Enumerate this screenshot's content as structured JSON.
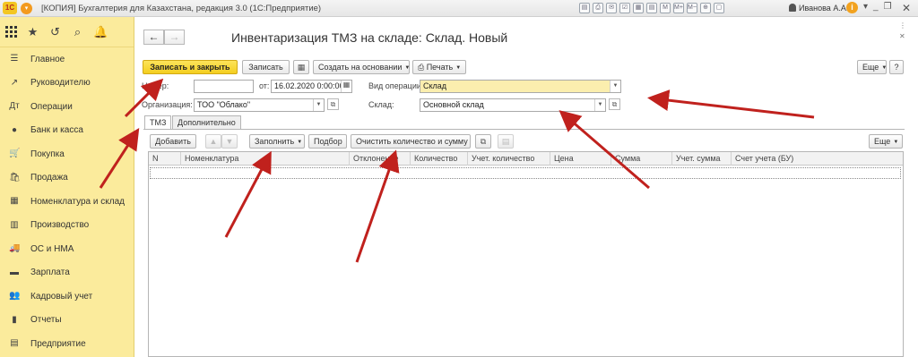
{
  "titlebar": {
    "logo": "1С",
    "title": "[КОПИЯ] Бухгалтерия для Казахстана, редакция 3.0  (1С:Предприятие)",
    "icons": [
      "▤",
      "⎙",
      "✉",
      "☑",
      "▦",
      "▤",
      "M",
      "M+",
      "M−",
      "⊕",
      "▢"
    ],
    "user": "Иванова А.А.",
    "info": "i",
    "menu": "▾",
    "minimize": "_",
    "restore": "❐",
    "close": "✕"
  },
  "leftpanel": {
    "tools": {
      "history": "↺",
      "search": "⌕",
      "bell": "🔔",
      "star": "★"
    },
    "items": [
      {
        "label": "Главное",
        "icon": "☰"
      },
      {
        "label": "Руководителю",
        "icon": "↗"
      },
      {
        "label": "Операции",
        "icon": "Дт"
      },
      {
        "label": "Банк и касса",
        "icon": "●"
      },
      {
        "label": "Покупка",
        "icon": "🛒"
      },
      {
        "label": "Продажа",
        "icon": "🛍"
      },
      {
        "label": "Номенклатура и склад",
        "icon": "▦"
      },
      {
        "label": "Производство",
        "icon": "▥"
      },
      {
        "label": "ОС и НМА",
        "icon": "🚚"
      },
      {
        "label": "Зарплата",
        "icon": "▬"
      },
      {
        "label": "Кадровый учет",
        "icon": "👥"
      },
      {
        "label": "Отчеты",
        "icon": "▮"
      },
      {
        "label": "Предприятие",
        "icon": "▤"
      }
    ]
  },
  "form": {
    "back": "←",
    "forward": "→",
    "title": "Инвентаризация ТМЗ на складе: Склад. Новый",
    "win_more": "⋮",
    "win_close": "✕",
    "toolbar": {
      "save_close": "Записать и закрыть",
      "save": "Записать",
      "create_basis": "Создать на основании",
      "print": "Печать",
      "more": "Еще",
      "help": "?"
    },
    "fields": {
      "number_label": "Номер:",
      "number_value": "",
      "date_label": "от:",
      "date_value": "16.02.2020  0:00:00",
      "operation_label": "Вид операции:",
      "operation_value": "Склад",
      "org_label": "Организация:",
      "org_value": "ТОО \"Облако\"",
      "warehouse_label": "Склад:",
      "warehouse_value": "Основной склад"
    },
    "tabs": [
      "ТМЗ",
      "Дополнительно"
    ],
    "table_toolbar": {
      "add": "Добавить",
      "fill": "Заполнить",
      "select": "Подбор",
      "clear_qty": "Очистить количество и сумму",
      "more": "Еще"
    },
    "columns": [
      "N",
      "Номенклатура",
      "Отклонение",
      "Количество",
      "Учет. количество",
      "Цена",
      "Сумма",
      "Учет. сумма",
      "Счет учета (БУ)"
    ]
  },
  "colors": {
    "panel": "#fbeb9c",
    "primary_button": "#f3ce20",
    "field_highlight": "#fbeeae",
    "arrow": "#c0211d"
  }
}
